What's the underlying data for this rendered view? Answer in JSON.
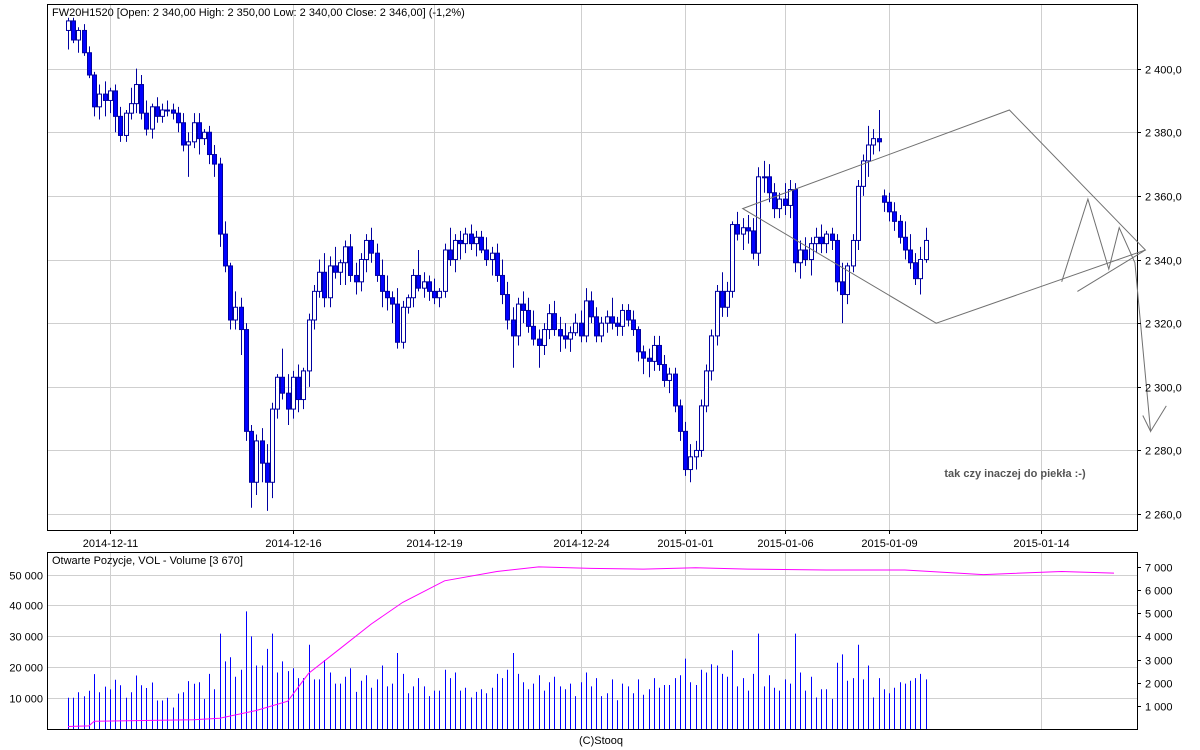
{
  "chart_data": [
    {
      "type": "candlestick",
      "title": "FW20H1520 [Open: 2 340,00  High: 2 350,00  Low: 2 340,00  Close: 2 346,00] (-1,2%)",
      "y_ticks": [
        "2 260,0",
        "2 280,0",
        "2 300,0",
        "2 320,0",
        "2 340,0",
        "2 360,0",
        "2 380,0",
        "2 400,0"
      ],
      "ylim": [
        2255,
        2420
      ],
      "x_ticks": [
        {
          "label": "2014-12-11",
          "index": 8
        },
        {
          "label": "2014-12-16",
          "index": 43
        },
        {
          "label": "2014-12-19",
          "index": 70
        },
        {
          "label": "2014-12-24",
          "index": 98
        },
        {
          "label": "2015-01-01",
          "index": 118
        },
        {
          "label": "2015-01-06",
          "index": 137
        },
        {
          "label": "2015-01-09",
          "index": 157
        },
        {
          "label": "2015-01-14",
          "index": 186
        }
      ],
      "bar_count": 200,
      "annotation": "tak czy inaczej do piekła :-)",
      "colors": {
        "bull": "#ffffff",
        "bear": "#0000ff",
        "wick": "#0000a0",
        "grid": "#cfcfcf",
        "pattern": "#707070"
      },
      "ohlc": [
        [
          2412,
          2416,
          2406,
          2415
        ],
        [
          2415,
          2416,
          2408,
          2409
        ],
        [
          2409,
          2413,
          2405,
          2412
        ],
        [
          2412,
          2414,
          2404,
          2405
        ],
        [
          2405,
          2407,
          2397,
          2398
        ],
        [
          2398,
          2399,
          2385,
          2388
        ],
        [
          2388,
          2395,
          2384,
          2392
        ],
        [
          2392,
          2396,
          2385,
          2390
        ],
        [
          2390,
          2394,
          2386,
          2393
        ],
        [
          2393,
          2395,
          2380,
          2385
        ],
        [
          2385,
          2388,
          2377,
          2379
        ],
        [
          2379,
          2387,
          2377,
          2386
        ],
        [
          2386,
          2394,
          2384,
          2389
        ],
        [
          2389,
          2400,
          2386,
          2395
        ],
        [
          2395,
          2398,
          2384,
          2386
        ],
        [
          2386,
          2390,
          2379,
          2381
        ],
        [
          2381,
          2389,
          2378,
          2388
        ],
        [
          2388,
          2391,
          2383,
          2385
        ],
        [
          2385,
          2389,
          2383,
          2387
        ],
        [
          2387,
          2390,
          2385,
          2387
        ],
        [
          2387,
          2389,
          2384,
          2386
        ],
        [
          2386,
          2388,
          2380,
          2383
        ],
        [
          2383,
          2386,
          2374,
          2376
        ],
        [
          2376,
          2380,
          2366,
          2377
        ],
        [
          2377,
          2386,
          2375,
          2383
        ],
        [
          2383,
          2386,
          2373,
          2378
        ],
        [
          2378,
          2381,
          2376,
          2380
        ],
        [
          2380,
          2382,
          2370,
          2373
        ],
        [
          2373,
          2376,
          2366,
          2370
        ],
        [
          2370,
          2372,
          2344,
          2348
        ],
        [
          2348,
          2352,
          2336,
          2338
        ],
        [
          2338,
          2339,
          2318,
          2321
        ],
        [
          2321,
          2330,
          2318,
          2325
        ],
        [
          2325,
          2328,
          2310,
          2318
        ],
        [
          2318,
          2320,
          2283,
          2286
        ],
        [
          2286,
          2288,
          2262,
          2270
        ],
        [
          2270,
          2285,
          2266,
          2283
        ],
        [
          2283,
          2287,
          2270,
          2276
        ],
        [
          2276,
          2282,
          2261,
          2270
        ],
        [
          2270,
          2295,
          2265,
          2293
        ],
        [
          2293,
          2304,
          2290,
          2303
        ],
        [
          2303,
          2312,
          2296,
          2298
        ],
        [
          2298,
          2304,
          2288,
          2293
        ],
        [
          2293,
          2305,
          2290,
          2303
        ],
        [
          2303,
          2307,
          2292,
          2296
        ],
        [
          2296,
          2306,
          2293,
          2305
        ],
        [
          2305,
          2323,
          2300,
          2321
        ],
        [
          2321,
          2332,
          2318,
          2330
        ],
        [
          2330,
          2340,
          2328,
          2336
        ],
        [
          2336,
          2342,
          2325,
          2328
        ],
        [
          2328,
          2341,
          2325,
          2338
        ],
        [
          2338,
          2344,
          2334,
          2336
        ],
        [
          2336,
          2340,
          2332,
          2339
        ],
        [
          2339,
          2346,
          2332,
          2344
        ],
        [
          2344,
          2348,
          2333,
          2335
        ],
        [
          2335,
          2339,
          2329,
          2333
        ],
        [
          2333,
          2342,
          2330,
          2340
        ],
        [
          2340,
          2348,
          2336,
          2346
        ],
        [
          2346,
          2350,
          2339,
          2342
        ],
        [
          2342,
          2345,
          2333,
          2335
        ],
        [
          2335,
          2340,
          2325,
          2330
        ],
        [
          2330,
          2335,
          2324,
          2328
        ],
        [
          2328,
          2330,
          2320,
          2326
        ],
        [
          2326,
          2331,
          2312,
          2314
        ],
        [
          2314,
          2327,
          2312,
          2325
        ],
        [
          2325,
          2329,
          2323,
          2328
        ],
        [
          2328,
          2337,
          2325,
          2335
        ],
        [
          2335,
          2343,
          2330,
          2331
        ],
        [
          2331,
          2336,
          2328,
          2333
        ],
        [
          2333,
          2335,
          2327,
          2330
        ],
        [
          2330,
          2334,
          2326,
          2328
        ],
        [
          2328,
          2331,
          2325,
          2330
        ],
        [
          2330,
          2345,
          2328,
          2343
        ],
        [
          2343,
          2350,
          2338,
          2340
        ],
        [
          2340,
          2348,
          2336,
          2346
        ],
        [
          2346,
          2349,
          2340,
          2345
        ],
        [
          2345,
          2350,
          2342,
          2348
        ],
        [
          2348,
          2351,
          2343,
          2345
        ],
        [
          2345,
          2349,
          2341,
          2347
        ],
        [
          2347,
          2349,
          2342,
          2343
        ],
        [
          2343,
          2347,
          2338,
          2340
        ],
        [
          2340,
          2344,
          2335,
          2342
        ],
        [
          2342,
          2345,
          2333,
          2335
        ],
        [
          2335,
          2340,
          2326,
          2329
        ],
        [
          2329,
          2333,
          2318,
          2321
        ],
        [
          2321,
          2325,
          2306,
          2316
        ],
        [
          2316,
          2328,
          2313,
          2326
        ],
        [
          2326,
          2330,
          2320,
          2324
        ],
        [
          2324,
          2328,
          2317,
          2319
        ],
        [
          2319,
          2324,
          2313,
          2315
        ],
        [
          2315,
          2318,
          2306,
          2313
        ],
        [
          2313,
          2320,
          2310,
          2318
        ],
        [
          2318,
          2326,
          2315,
          2323
        ],
        [
          2323,
          2327,
          2316,
          2318
        ],
        [
          2318,
          2322,
          2311,
          2316
        ],
        [
          2316,
          2320,
          2312,
          2315
        ],
        [
          2315,
          2319,
          2311,
          2317
        ],
        [
          2317,
          2323,
          2316,
          2320
        ],
        [
          2320,
          2324,
          2314,
          2316
        ],
        [
          2316,
          2331,
          2314,
          2327
        ],
        [
          2327,
          2330,
          2320,
          2322
        ],
        [
          2322,
          2325,
          2314,
          2316
        ],
        [
          2316,
          2322,
          2314,
          2320
        ],
        [
          2320,
          2324,
          2317,
          2322
        ],
        [
          2322,
          2328,
          2318,
          2320
        ],
        [
          2320,
          2322,
          2316,
          2319
        ],
        [
          2319,
          2326,
          2316,
          2324
        ],
        [
          2324,
          2326,
          2319,
          2321
        ],
        [
          2321,
          2324,
          2316,
          2318
        ],
        [
          2318,
          2319,
          2308,
          2311
        ],
        [
          2311,
          2313,
          2304,
          2309
        ],
        [
          2309,
          2312,
          2303,
          2308
        ],
        [
          2308,
          2316,
          2305,
          2313
        ],
        [
          2313,
          2316,
          2305,
          2307
        ],
        [
          2307,
          2310,
          2300,
          2302
        ],
        [
          2302,
          2306,
          2298,
          2304
        ],
        [
          2304,
          2306,
          2292,
          2294
        ],
        [
          2294,
          2296,
          2283,
          2286
        ],
        [
          2286,
          2289,
          2272,
          2274
        ],
        [
          2274,
          2282,
          2270,
          2278
        ],
        [
          2278,
          2283,
          2274,
          2280
        ],
        [
          2280,
          2296,
          2278,
          2294
        ],
        [
          2294,
          2307,
          2292,
          2305
        ],
        [
          2305,
          2318,
          2302,
          2316
        ],
        [
          2316,
          2332,
          2313,
          2330
        ],
        [
          2330,
          2336,
          2322,
          2325
        ],
        [
          2325,
          2333,
          2322,
          2330
        ],
        [
          2330,
          2352,
          2328,
          2351
        ],
        [
          2351,
          2355,
          2346,
          2348
        ],
        [
          2348,
          2353,
          2343,
          2350
        ],
        [
          2350,
          2354,
          2345,
          2349
        ],
        [
          2349,
          2353,
          2340,
          2342
        ],
        [
          2342,
          2369,
          2338,
          2366
        ],
        [
          2366,
          2371,
          2361,
          2366
        ],
        [
          2366,
          2370,
          2358,
          2361
        ],
        [
          2361,
          2364,
          2353,
          2356
        ],
        [
          2356,
          2361,
          2353,
          2359
        ],
        [
          2359,
          2364,
          2354,
          2357
        ],
        [
          2357,
          2365,
          2353,
          2362
        ],
        [
          2362,
          2364,
          2336,
          2339
        ],
        [
          2339,
          2346,
          2334,
          2343
        ],
        [
          2343,
          2347,
          2338,
          2340
        ],
        [
          2340,
          2347,
          2335,
          2345
        ],
        [
          2345,
          2350,
          2342,
          2347
        ],
        [
          2347,
          2351,
          2342,
          2345
        ],
        [
          2345,
          2349,
          2342,
          2348
        ],
        [
          2348,
          2350,
          2343,
          2346
        ],
        [
          2346,
          2348,
          2330,
          2333
        ],
        [
          2333,
          2339,
          2320,
          2329
        ],
        [
          2329,
          2339,
          2326,
          2338
        ],
        [
          2338,
          2348,
          2336,
          2346
        ],
        [
          2346,
          2365,
          2343,
          2363
        ],
        [
          2363,
          2373,
          2360,
          2371
        ],
        [
          2371,
          2382,
          2366,
          2376
        ],
        [
          2376,
          2381,
          2373,
          2378
        ],
        [
          2378,
          2387,
          2374,
          2377
        ],
        [
          2360,
          2362,
          2355,
          2358
        ],
        [
          2358,
          2361,
          2352,
          2355
        ],
        [
          2355,
          2358,
          2349,
          2352
        ],
        [
          2352,
          2354,
          2345,
          2347
        ],
        [
          2347,
          2352,
          2340,
          2343
        ],
        [
          2343,
          2348,
          2337,
          2339
        ],
        [
          2339,
          2342,
          2332,
          2334
        ],
        [
          2334,
          2344,
          2329,
          2340
        ],
        [
          2340,
          2350,
          2339,
          2346
        ]
      ],
      "pattern_note": "rhombus outline with projected zig-zag path"
    },
    {
      "type": "bar+line",
      "title": "Otwarte Pozycje, VOL - Volume [3 670]",
      "left_axis_ticks": [
        "10 000",
        "20 000",
        "30 000",
        "40 000",
        "50 000"
      ],
      "left_ylim": [
        0,
        57000
      ],
      "right_axis_ticks": [
        "1 000",
        "2 000",
        "3 000",
        "4 000",
        "5 000",
        "6 000",
        "7 000"
      ],
      "right_ylim": [
        0,
        7600
      ],
      "volume_color": "#0000ff",
      "oi_color": "#ff00ff",
      "footer": "(C)Stooq"
    }
  ]
}
